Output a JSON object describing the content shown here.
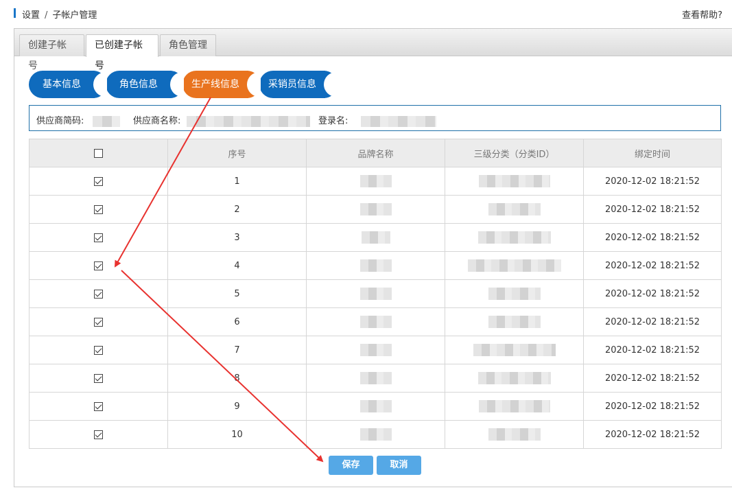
{
  "breadcrumb": {
    "part1": "设置",
    "separator": "/",
    "part2": "子帐户管理"
  },
  "help_link": "查看帮助?",
  "tabs": [
    {
      "label": "创建子帐号",
      "active": false
    },
    {
      "label": "已创建子帐号",
      "active": true
    },
    {
      "label": "角色管理",
      "active": false
    }
  ],
  "steps": [
    {
      "label": "基本信息",
      "color": "#0f6bbd"
    },
    {
      "label": "角色信息",
      "color": "#0f6bbd"
    },
    {
      "label": "生产线信息",
      "color": "#e9731e",
      "current": true
    },
    {
      "label": "采销员信息",
      "color": "#0f6bbd"
    }
  ],
  "info": {
    "code_label": "供应商简码:",
    "name_label": "供应商名称:",
    "login_label": "登录名:"
  },
  "table": {
    "headers": [
      "序号",
      "品牌名称",
      "三级分类（分类ID）",
      "绑定时间"
    ],
    "rows": [
      {
        "seq": "1",
        "time": "2020-12-02 18:21:52",
        "checked": true
      },
      {
        "seq": "2",
        "time": "2020-12-02 18:21:52",
        "checked": true
      },
      {
        "seq": "3",
        "time": "2020-12-02 18:21:52",
        "checked": true
      },
      {
        "seq": "4",
        "time": "2020-12-02 18:21:52",
        "checked": true
      },
      {
        "seq": "5",
        "time": "2020-12-02 18:21:52",
        "checked": true
      },
      {
        "seq": "6",
        "time": "2020-12-02 18:21:52",
        "checked": true
      },
      {
        "seq": "7",
        "time": "2020-12-02 18:21:52",
        "checked": true
      },
      {
        "seq": "8",
        "time": "2020-12-02 18:21:52",
        "checked": true
      },
      {
        "seq": "9",
        "time": "2020-12-02 18:21:52",
        "checked": true
      },
      {
        "seq": "10",
        "time": "2020-12-02 18:21:52",
        "checked": true
      }
    ]
  },
  "buttons": {
    "save": "保存",
    "cancel": "取消"
  },
  "colors": {
    "accent": "#0f6bbd",
    "current_step": "#e9731e",
    "button": "#55a8e6",
    "annotation_arrow": "#e8322f"
  }
}
